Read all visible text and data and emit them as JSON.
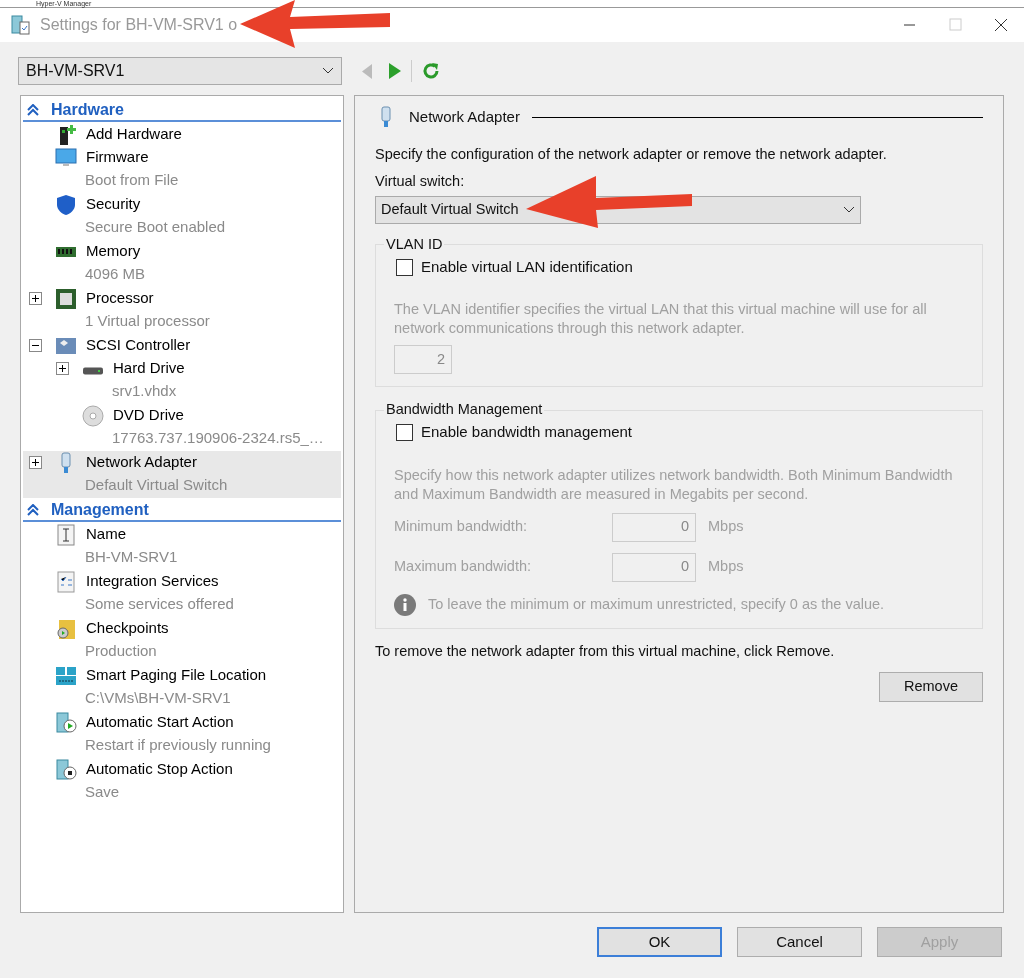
{
  "background_window": {
    "title": "Hyper-V Manager"
  },
  "window": {
    "title": "Settings for BH-VM-SRV1 o"
  },
  "vm_selector": {
    "value": "BH-VM-SRV1"
  },
  "sidebar": {
    "sections": [
      {
        "title": "Hardware",
        "expanded": true,
        "items": [
          {
            "kind": "add-hardware",
            "label": "Add Hardware",
            "selected": false
          },
          {
            "kind": "firmware",
            "label": "Firmware",
            "sub": "Boot from File",
            "selected": false
          },
          {
            "kind": "security",
            "label": "Security",
            "sub": "Secure Boot enabled",
            "selected": false
          },
          {
            "kind": "memory",
            "label": "Memory",
            "sub": "4096 MB",
            "selected": false
          },
          {
            "kind": "processor",
            "label": "Processor",
            "sub": "1 Virtual processor",
            "expanded": false,
            "selected": false
          },
          {
            "kind": "scsi",
            "label": "SCSI Controller",
            "expanded": true,
            "selected": false,
            "children": [
              {
                "kind": "hard-drive",
                "label": "Hard Drive",
                "sub": "srv1.vhdx",
                "expanded": false,
                "selected": false
              },
              {
                "kind": "dvd",
                "label": "DVD Drive",
                "sub": "17763.737.190906-2324.rs5_…",
                "selected": false
              }
            ]
          },
          {
            "kind": "network",
            "label": "Network Adapter",
            "sub": "Default Virtual Switch",
            "expanded": false,
            "selected": true
          }
        ]
      },
      {
        "title": "Management",
        "expanded": true,
        "items": [
          {
            "kind": "name",
            "label": "Name",
            "sub": "BH-VM-SRV1",
            "selected": false
          },
          {
            "kind": "integration",
            "label": "Integration Services",
            "sub": "Some services offered",
            "selected": false
          },
          {
            "kind": "checkpoints",
            "label": "Checkpoints",
            "sub": "Production",
            "selected": false
          },
          {
            "kind": "paging",
            "label": "Smart Paging File Location",
            "sub": "C:\\VMs\\BH-VM-SRV1",
            "selected": false
          },
          {
            "kind": "start",
            "label": "Automatic Start Action",
            "sub": "Restart if previously running",
            "selected": false
          },
          {
            "kind": "stop",
            "label": "Automatic Stop Action",
            "sub": "Save",
            "selected": false
          }
        ]
      }
    ]
  },
  "panel": {
    "title": "Network Adapter",
    "description": "Specify the configuration of the network adapter or remove the network adapter.",
    "virtual_switch": {
      "label": "Virtual switch:",
      "value": "Default Virtual Switch"
    },
    "vlan": {
      "title": "VLAN ID",
      "checkbox": {
        "label": "Enable virtual LAN identification",
        "checked": false
      },
      "help": "The VLAN identifier specifies the virtual LAN that this virtual machine will use for all network communications through this network adapter.",
      "value": "2"
    },
    "bandwidth": {
      "title": "Bandwidth Management",
      "checkbox": {
        "label": "Enable bandwidth management",
        "checked": false
      },
      "help": "Specify how this network adapter utilizes network bandwidth. Both Minimum Bandwidth and Maximum Bandwidth are measured in Megabits per second.",
      "fields": [
        {
          "label": "Minimum bandwidth:",
          "value": "0",
          "unit": "Mbps"
        },
        {
          "label": "Maximum bandwidth:",
          "value": "0",
          "unit": "Mbps"
        }
      ],
      "note": "To leave the minimum or maximum unrestricted, specify 0 as the value."
    },
    "remove_text": "To remove the network adapter from this virtual machine, click Remove.",
    "remove_button": "Remove"
  },
  "buttons": [
    {
      "label": "OK",
      "disabled": false,
      "default": true
    },
    {
      "label": "Cancel",
      "disabled": false,
      "default": false
    },
    {
      "label": "Apply",
      "disabled": true,
      "default": false
    }
  ]
}
